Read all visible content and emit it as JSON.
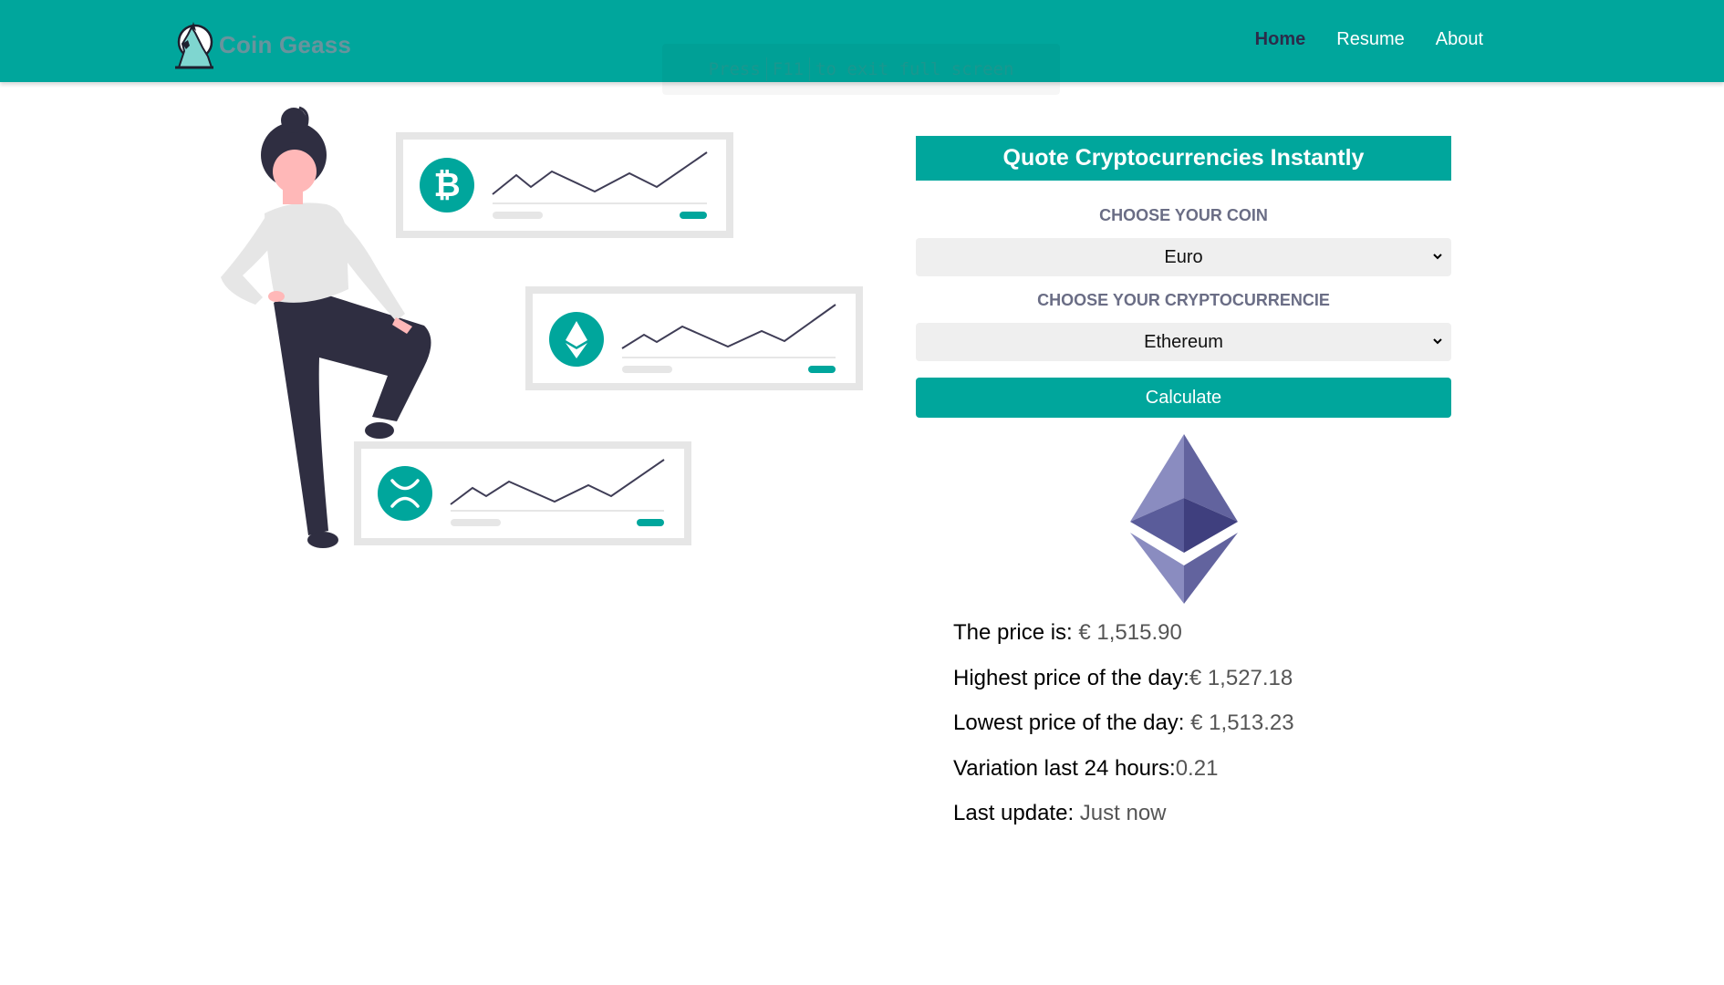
{
  "brand": {
    "name": "Coin Geass"
  },
  "nav": {
    "items": [
      "Home",
      "Resume",
      "About"
    ],
    "active": "Home"
  },
  "fullscreen_notice": {
    "before": "Press",
    "key": "F11",
    "after": "to exit full screen"
  },
  "panel": {
    "title": "Quote Cryptocurrencies Instantly",
    "coin_label": "CHOOSE YOUR COIN",
    "coin_value": "Euro",
    "crypto_label": "CHOOSE YOUR CRYPTOCURRENCIE",
    "crypto_value": "Ethereum",
    "button_label": "Calculate"
  },
  "results": {
    "price_label": "The price is:",
    "price_value": "€ 1,515.90",
    "high_label": "Highest price of the day:",
    "high_value": "€ 1,527.18",
    "low_label": "Lowest price of the day:",
    "low_value": "€ 1,513.23",
    "variation_label": "Variation last 24 hours:",
    "variation_value": "0.21",
    "update_label": "Last update:",
    "update_value": "Just now"
  },
  "illustration": {
    "cards": [
      {
        "icon": "bitcoin-icon"
      },
      {
        "icon": "ethereum-icon"
      },
      {
        "icon": "xrp-icon"
      }
    ]
  },
  "icons": {
    "brand_logo": "howling-wolf-icon",
    "coin_logo": "ethereum-icon",
    "select_arrow": "chevron-down-icon"
  },
  "colors": {
    "accent": "#00a69c",
    "nav_active": "#2c2c4a",
    "label": "#6a6d85",
    "person_dark": "#2f2e41",
    "skin": "#ffb8b8"
  }
}
